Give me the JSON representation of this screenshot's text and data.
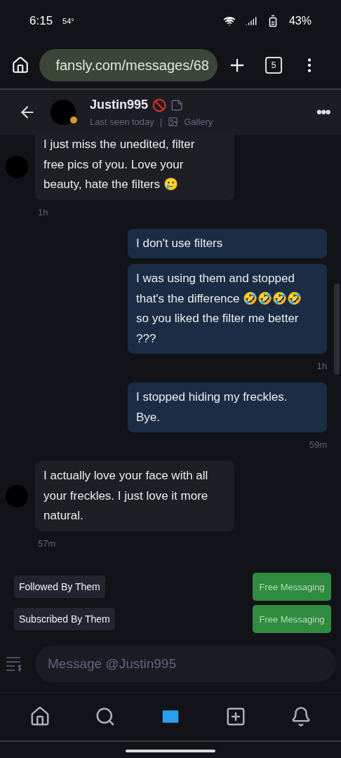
{
  "status_bar": {
    "time": "6:15",
    "temperature": "54°",
    "battery": "43%"
  },
  "browser": {
    "url": "fansly.com/messages/68",
    "tab_count": "5"
  },
  "chat_header": {
    "name": "Justin995",
    "blocked": true,
    "online": true,
    "last_seen": "Last seen today",
    "separator": "|",
    "gallery": "Gallery",
    "more": "•••"
  },
  "messages": [
    {
      "kind": "received",
      "text": "I just miss the unedited, filter free pics of you. Love your beauty, hate the filters 🥲"
    },
    {
      "kind": "received_time",
      "text": "1h"
    },
    {
      "kind": "sent",
      "text": "I don't use filters"
    },
    {
      "kind": "sent",
      "text": "I was using them and stopped that's the difference 🤣🤣🤣🤣 so you liked the filter me better ???"
    },
    {
      "kind": "sent_time",
      "text": "1h"
    },
    {
      "kind": "sent",
      "text": "I stopped hiding my freckles. Bye."
    },
    {
      "kind": "sent_time",
      "text": "59m"
    },
    {
      "kind": "received",
      "text": "I actually love your face with all your freckles. I just love it more natural."
    },
    {
      "kind": "received_time",
      "text": "57m"
    },
    {
      "kind": "stub"
    }
  ],
  "relations": [
    {
      "label": "Followed By Them",
      "action": "Free Messaging"
    },
    {
      "label": "Subscribed By Them",
      "action": "Free Messaging"
    }
  ],
  "composer": {
    "placeholder": "Message @Justin995"
  },
  "bottom_nav": [
    {
      "kind": "home",
      "selected": false
    },
    {
      "kind": "search",
      "selected": false
    },
    {
      "kind": "messages",
      "selected": true
    },
    {
      "kind": "create",
      "selected": false
    },
    {
      "kind": "notifications",
      "selected": false
    }
  ]
}
